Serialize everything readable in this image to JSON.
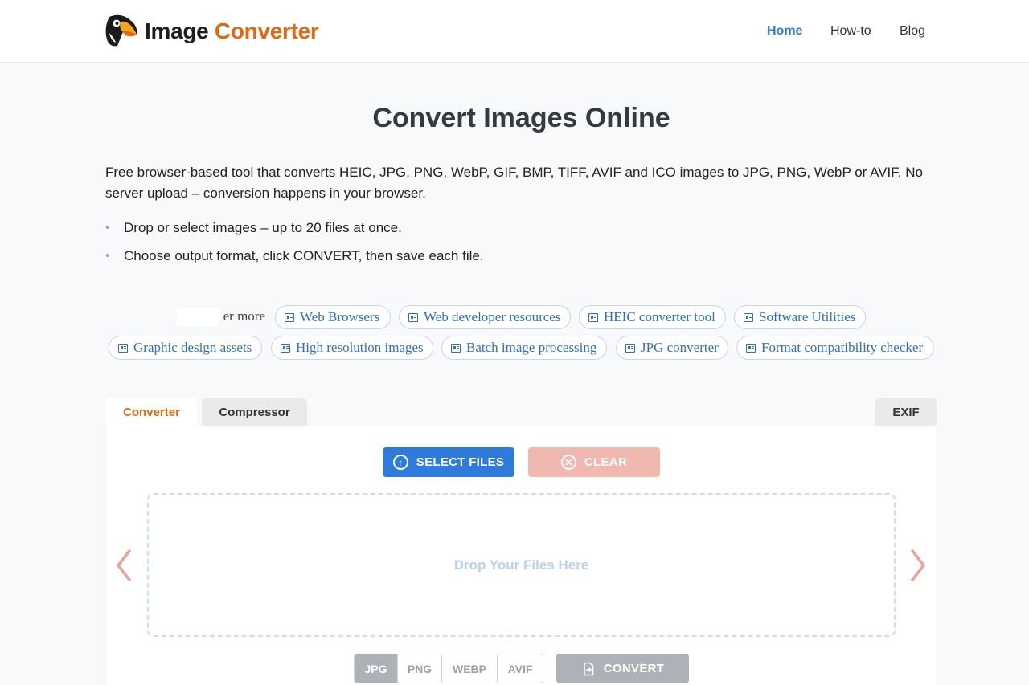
{
  "header": {
    "logo_word1": "Image",
    "logo_word2": "Converter",
    "nav": [
      {
        "label": "Home",
        "active": true
      },
      {
        "label": "How-to",
        "active": false
      },
      {
        "label": "Blog",
        "active": false
      }
    ]
  },
  "main": {
    "title": "Convert Images Online",
    "description": "Free browser-based tool that converts HEIC, JPG, PNG, WebP, GIF, BMP, TIFF, AVIF and ICO images to JPG, PNG, WebP or AVIF. No server upload – conversion happens in your browser.",
    "bullets": [
      "Drop or select images – up to 20 files at once.",
      "Choose output format, click CONVERT, then save each file."
    ]
  },
  "discover": {
    "label": "er more",
    "chips": [
      "Web Browsers",
      "Web developer resources",
      "HEIC converter tool",
      "Software Utilities",
      "Graphic design assets",
      "High resolution images",
      "Batch image processing",
      "JPG converter",
      "Format compatibility checker"
    ]
  },
  "tabs": [
    {
      "label": "Converter",
      "active": true
    },
    {
      "label": "Compressor",
      "active": false
    },
    {
      "label": "EXIF",
      "active": false
    }
  ],
  "converter": {
    "select_files_label": "SELECT FILES",
    "clear_label": "CLEAR",
    "dropzone_text": "Drop Your Files Here",
    "formats": [
      "JPG",
      "PNG",
      "WEBP",
      "AVIF"
    ],
    "selected_format": "JPG",
    "convert_label": "CONVERT"
  },
  "colors": {
    "accent_blue": "#2f7bdc",
    "brand_orange": "#e06a14",
    "clear_disabled": "#f0b8ae",
    "convert_disabled": "#adb2b8",
    "arrow": "#e8a496"
  },
  "icons": {
    "logo": "toucan-logo-icon",
    "chip": "newspaper-icon",
    "select": "upload-circle-icon",
    "clear": "close-circle-icon",
    "convert": "file-convert-icon",
    "prev": "chevron-left-icon",
    "next": "chevron-right-icon"
  }
}
